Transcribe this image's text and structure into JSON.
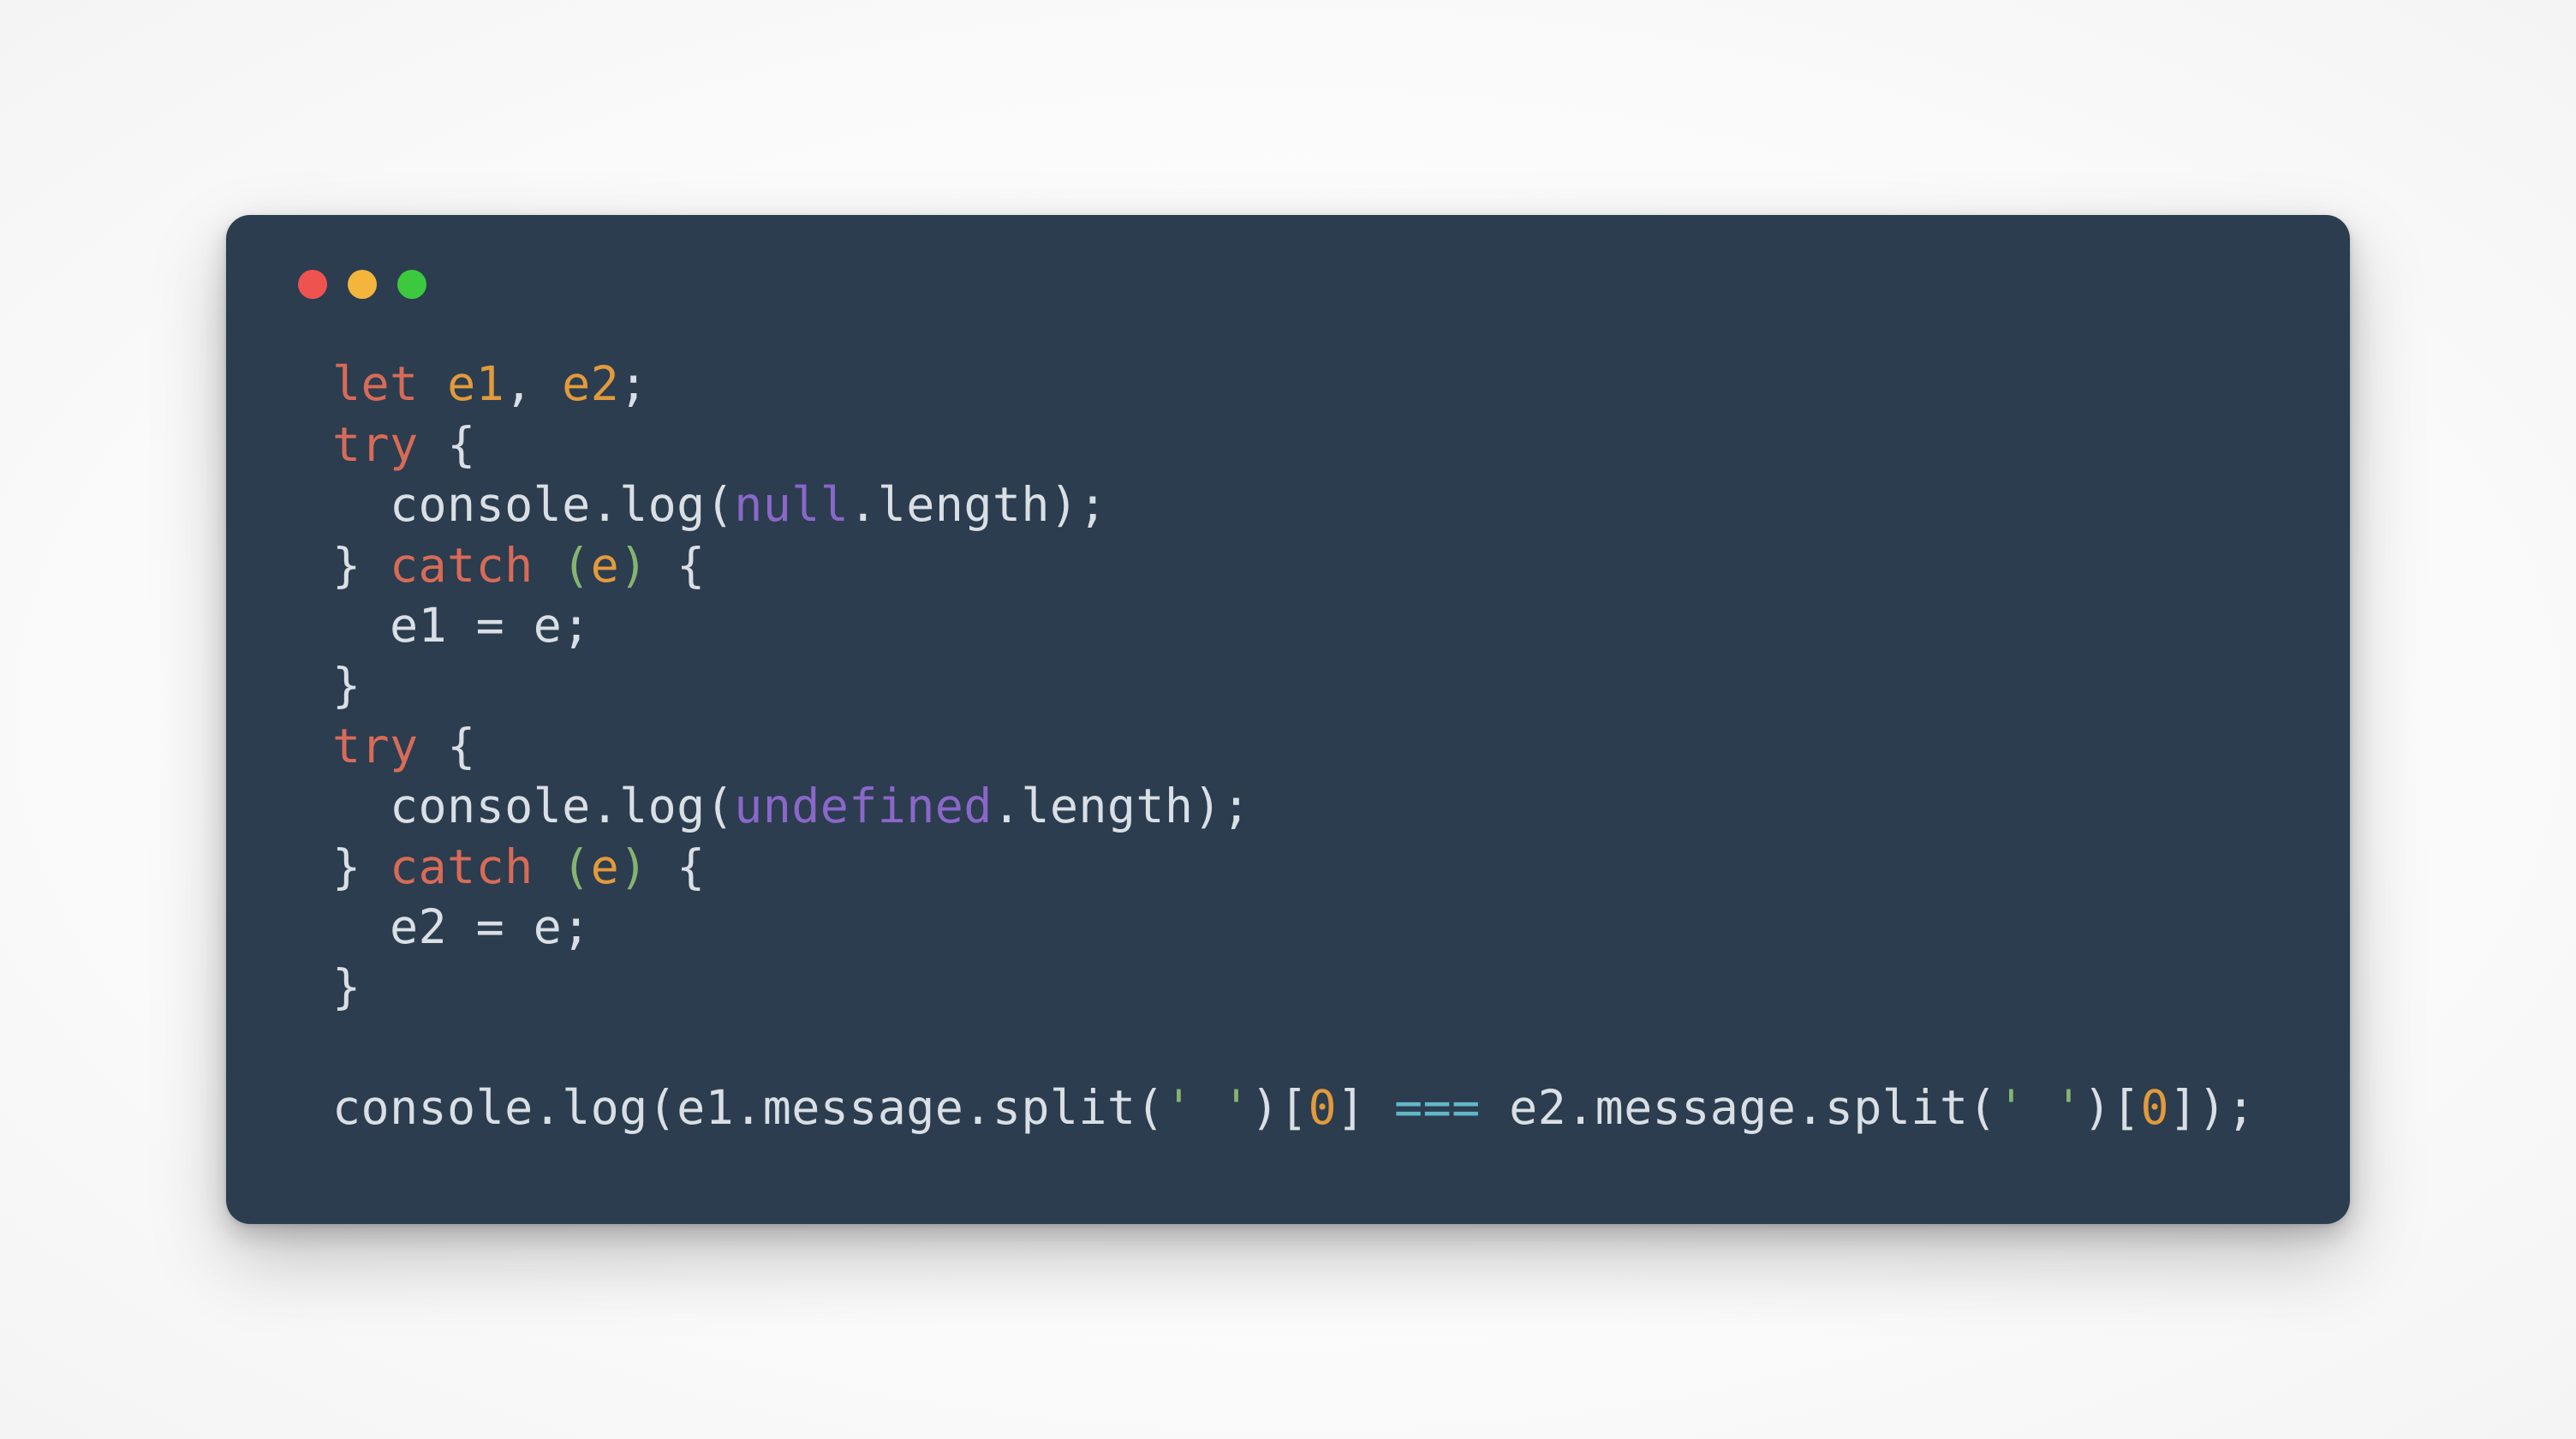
{
  "window": {
    "traffic_lights": [
      "close",
      "minimize",
      "zoom"
    ]
  },
  "code": {
    "lines": [
      [
        {
          "t": "let ",
          "c": "kd"
        },
        {
          "t": "e1",
          "c": "decl"
        },
        {
          "t": ", ",
          "c": "pn"
        },
        {
          "t": "e2",
          "c": "decl"
        },
        {
          "t": ";",
          "c": "pn"
        }
      ],
      [
        {
          "t": "try ",
          "c": "kw"
        },
        {
          "t": "{",
          "c": "pn"
        }
      ],
      [
        {
          "t": "  console",
          "c": "id"
        },
        {
          "t": ".",
          "c": "pn"
        },
        {
          "t": "log",
          "c": "fn"
        },
        {
          "t": "(",
          "c": "pn"
        },
        {
          "t": "null",
          "c": "nul"
        },
        {
          "t": ".",
          "c": "pn"
        },
        {
          "t": "length",
          "c": "id"
        },
        {
          "t": ");",
          "c": "pn"
        }
      ],
      [
        {
          "t": "} ",
          "c": "pn"
        },
        {
          "t": "catch ",
          "c": "kw"
        },
        {
          "t": "(",
          "c": "par"
        },
        {
          "t": "e",
          "c": "parm"
        },
        {
          "t": ")",
          "c": "par"
        },
        {
          "t": " {",
          "c": "pn"
        }
      ],
      [
        {
          "t": "  e1 ",
          "c": "id"
        },
        {
          "t": "= ",
          "c": "op"
        },
        {
          "t": "e",
          "c": "id"
        },
        {
          "t": ";",
          "c": "pn"
        }
      ],
      [
        {
          "t": "}",
          "c": "pn"
        }
      ],
      [
        {
          "t": "try ",
          "c": "kw"
        },
        {
          "t": "{",
          "c": "pn"
        }
      ],
      [
        {
          "t": "  console",
          "c": "id"
        },
        {
          "t": ".",
          "c": "pn"
        },
        {
          "t": "log",
          "c": "fn"
        },
        {
          "t": "(",
          "c": "pn"
        },
        {
          "t": "undefined",
          "c": "nul"
        },
        {
          "t": ".",
          "c": "pn"
        },
        {
          "t": "length",
          "c": "id"
        },
        {
          "t": ");",
          "c": "pn"
        }
      ],
      [
        {
          "t": "} ",
          "c": "pn"
        },
        {
          "t": "catch ",
          "c": "kw"
        },
        {
          "t": "(",
          "c": "par"
        },
        {
          "t": "e",
          "c": "parm"
        },
        {
          "t": ")",
          "c": "par"
        },
        {
          "t": " {",
          "c": "pn"
        }
      ],
      [
        {
          "t": "  e2 ",
          "c": "id"
        },
        {
          "t": "= ",
          "c": "op"
        },
        {
          "t": "e",
          "c": "id"
        },
        {
          "t": ";",
          "c": "pn"
        }
      ],
      [
        {
          "t": "}",
          "c": "pn"
        }
      ],
      [
        {
          "t": "",
          "c": "pn"
        }
      ],
      [
        {
          "t": "console",
          "c": "id"
        },
        {
          "t": ".",
          "c": "pn"
        },
        {
          "t": "log",
          "c": "fn"
        },
        {
          "t": "(",
          "c": "pn"
        },
        {
          "t": "e1",
          "c": "id"
        },
        {
          "t": ".",
          "c": "pn"
        },
        {
          "t": "message",
          "c": "id"
        },
        {
          "t": ".",
          "c": "pn"
        },
        {
          "t": "split",
          "c": "fn"
        },
        {
          "t": "(",
          "c": "pn"
        },
        {
          "t": "' '",
          "c": "str"
        },
        {
          "t": ")[",
          "c": "pn"
        },
        {
          "t": "0",
          "c": "num"
        },
        {
          "t": "] ",
          "c": "pn"
        },
        {
          "t": "===",
          "c": "cmp"
        },
        {
          "t": " e2",
          "c": "id"
        },
        {
          "t": ".",
          "c": "pn"
        },
        {
          "t": "message",
          "c": "id"
        },
        {
          "t": ".",
          "c": "pn"
        },
        {
          "t": "split",
          "c": "fn"
        },
        {
          "t": "(",
          "c": "pn"
        },
        {
          "t": "' '",
          "c": "str"
        },
        {
          "t": ")[",
          "c": "pn"
        },
        {
          "t": "0",
          "c": "num"
        },
        {
          "t": "]);",
          "c": "pn"
        }
      ]
    ]
  }
}
